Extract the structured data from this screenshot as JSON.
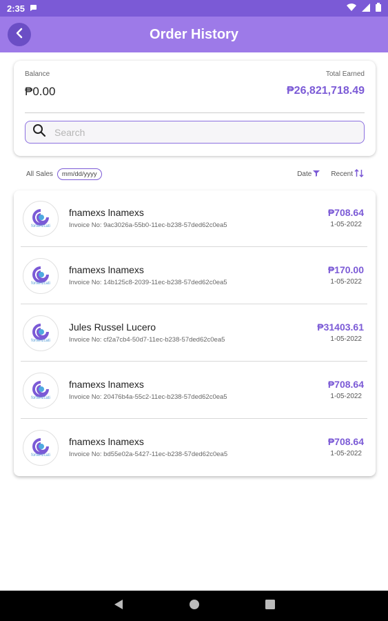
{
  "status_bar": {
    "time": "2:35"
  },
  "app_bar": {
    "title": "Order History"
  },
  "balance": {
    "balance_label": "Balance",
    "balance_value": "₱0.00",
    "earned_label": "Total Earned",
    "earned_value": "₱26,821,718.49"
  },
  "search": {
    "placeholder": "Search",
    "icon": "search-icon"
  },
  "filters": {
    "all_sales_label": "All Sales",
    "date_placeholder": "mm/dd/yyyy",
    "date_sort_label": "Date",
    "recent_sort_label": "Recent"
  },
  "orders": [
    {
      "customer": "fnamexs lnamexs",
      "invoice": "Invoice No: 9ac3026a-55b0-11ec-b238-57ded62c0ea5",
      "amount": "₱708.64",
      "date": "1-05-2022",
      "logo_text": "fortenzcati"
    },
    {
      "customer": "fnamexs lnamexs",
      "invoice": "Invoice No: 14b125c8-2039-11ec-b238-57ded62c0ea5",
      "amount": "₱170.00",
      "date": "1-05-2022",
      "logo_text": "fortenzcati"
    },
    {
      "customer": "Jules Russel Lucero",
      "invoice": "Invoice No: cf2a7cb4-50d7-11ec-b238-57ded62c0ea5",
      "amount": "₱31403.61",
      "date": "1-05-2022",
      "logo_text": "fortenzcati"
    },
    {
      "customer": "fnamexs lnamexs",
      "invoice": "Invoice No: 20476b4a-55c2-11ec-b238-57ded62c0ea5",
      "amount": "₱708.64",
      "date": "1-05-2022",
      "logo_text": "fortenzcati"
    },
    {
      "customer": "fnamexs lnamexs",
      "invoice": "Invoice No: bd55e02a-5427-11ec-b238-57ded62c0ea5",
      "amount": "₱708.64",
      "date": "1-05-2022",
      "logo_text": "fortenzcati"
    }
  ],
  "colors": {
    "accent": "#7b5ad6",
    "app_bar": "#9d7ae8",
    "status_bar": "#7b5ad6"
  }
}
